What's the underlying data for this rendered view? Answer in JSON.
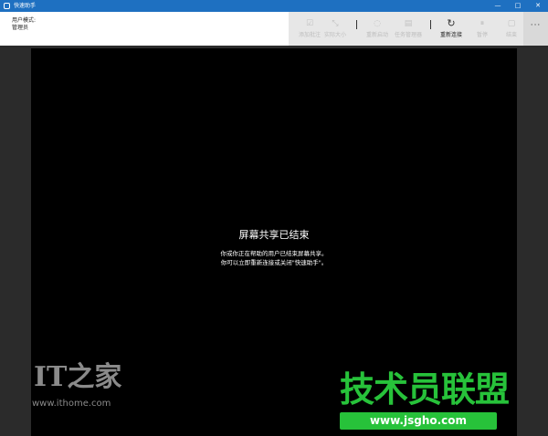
{
  "window": {
    "title": "快速助手",
    "minimize": "—",
    "maximize": "□",
    "close": "✕"
  },
  "user": {
    "mode_label": "用户模式:",
    "role": "管理员"
  },
  "toolbar": {
    "items": [
      {
        "label": "添加批注",
        "icon": "annotate-icon",
        "glyph": "☑",
        "enabled": false
      },
      {
        "label": "实际大小",
        "icon": "actual-size-icon",
        "glyph": "⤡",
        "enabled": false
      },
      {
        "label": "重新启动",
        "icon": "restart-icon",
        "glyph": "◌",
        "enabled": false
      },
      {
        "label": "任务管理器",
        "icon": "task-manager-icon",
        "glyph": "▤",
        "enabled": false
      },
      {
        "label": "重新连接",
        "icon": "reconnect-icon",
        "glyph": "↻",
        "enabled": true
      },
      {
        "label": "暂停",
        "icon": "pause-icon",
        "glyph": "⏸",
        "enabled": false
      },
      {
        "label": "结束",
        "icon": "end-icon",
        "glyph": "▢",
        "enabled": false
      }
    ],
    "more": "···"
  },
  "screen": {
    "title": "屏幕共享已结束",
    "line1": "你或你正在帮助的用户已结束屏幕共享。",
    "line2": "你可以立即重新连接或关闭\"快速助手\"。"
  },
  "watermarks": {
    "it_logo": "IT之家",
    "it_site": "www.ithome.com",
    "brand": "技术员联盟",
    "brand_url": "www.jsgho.com"
  }
}
